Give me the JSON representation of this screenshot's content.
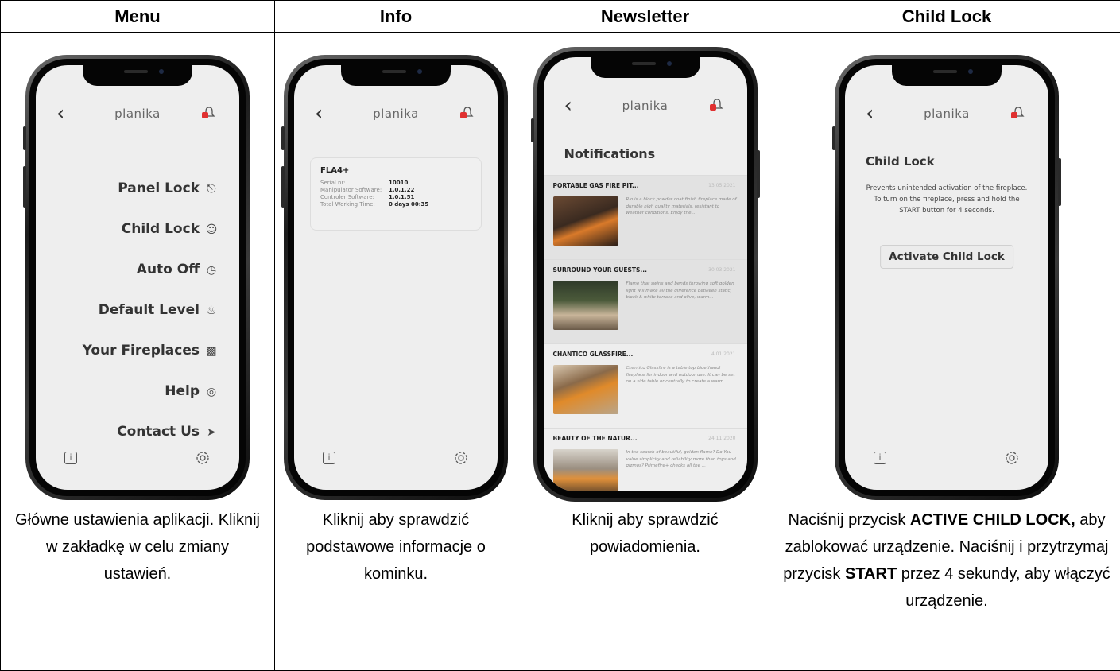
{
  "columns": [
    {
      "header": "Menu"
    },
    {
      "header": "Info"
    },
    {
      "header": "Newsletter"
    },
    {
      "header": "Child Lock"
    }
  ],
  "app": {
    "brand": "planika",
    "back": "‹"
  },
  "menu": {
    "items": [
      {
        "label": "Panel Lock",
        "icon": "lock-icon"
      },
      {
        "label": "Child Lock",
        "icon": "child-icon"
      },
      {
        "label": "Auto Off",
        "icon": "clock-icon"
      },
      {
        "label": "Default Level",
        "icon": "flame-icon"
      },
      {
        "label": "Your Fireplaces",
        "icon": "fireplace-icon"
      },
      {
        "label": "Help",
        "icon": "lifebuoy-icon"
      },
      {
        "label": "Contact Us",
        "icon": "send-icon"
      }
    ]
  },
  "info": {
    "device": "FLA4+",
    "rows": [
      {
        "key": "Serial nr:",
        "value": "10010"
      },
      {
        "key": "Manipulator Software:",
        "value": "1.0.1.22"
      },
      {
        "key": "Controler Software:",
        "value": "1.0.1.51"
      },
      {
        "key": "Total Working Time:",
        "value": "0 days  00:35"
      }
    ]
  },
  "newsletter": {
    "title": "Notifications",
    "items": [
      {
        "title": "PORTABLE GAS FIRE PIT...",
        "date": "13.05.2021",
        "text": "Rio is a block powder coat finish fireplace made of durable high quality materials, resistant to weather conditions. Enjoy the..."
      },
      {
        "title": "SURROUND YOUR GUESTS...",
        "date": "30.03.2021",
        "text": "Flame that swirls and bends throwing soft golden light will make all the difference between static, block & white terrace and olive, warm..."
      },
      {
        "title": "CHANTICO GLASSFIRE...",
        "date": "4.01.2021",
        "text": "Chantico Glassfire is a table top bioethanol fireplace for indoor and outdoor use. It can be set on a side table or centrally to create a warm..."
      },
      {
        "title": "BEAUTY OF THE NATUR...",
        "date": "24.11.2020",
        "text": "In the search of beautiful, golden flame? Do You value simplicity and reliability more than toys and gizmos? Primefire+ checks all the ..."
      }
    ]
  },
  "childlock": {
    "title": "Child Lock",
    "description": "Prevents unintended activation of the fireplace. To turn on the fireplace, press and hold the START button for 4 seconds.",
    "button": "Activate Child Lock"
  },
  "captions": {
    "menu": "Główne ustawienia aplikacji. Kliknij w zakładkę w celu zmiany ustawień.",
    "info": "Kliknij aby sprawdzić podstawowe informacje o kominku.",
    "newsletter": "Kliknij aby sprawdzić powiadomienia.",
    "childlock": {
      "p1": "Naciśnij przycisk ",
      "b1": "ACTIVE CHILD LOCK,",
      "p2": " aby zablokować urządzenie. Naciśnij i przytrzymaj przycisk ",
      "b2": "START",
      "p3": " przez 4 sekundy, aby włączyć urządzenie."
    }
  },
  "colors": {
    "badge": "#e03030",
    "screen": "#eeeeee"
  }
}
